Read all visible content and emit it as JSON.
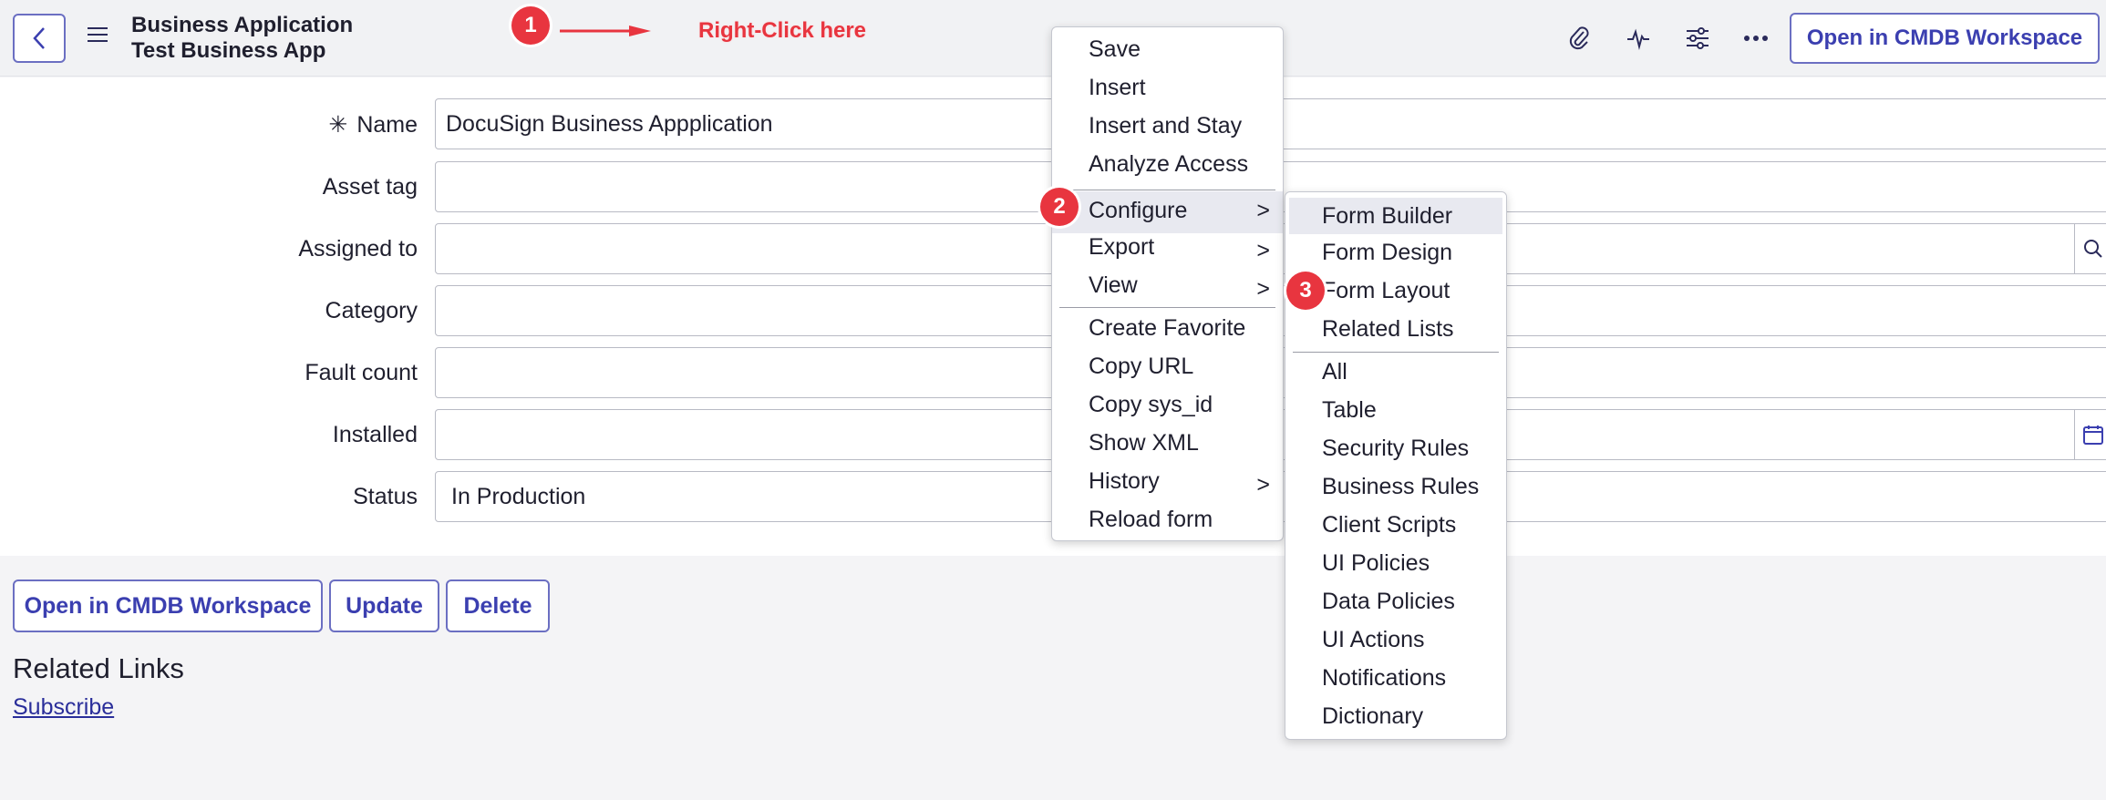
{
  "header": {
    "title_line1": "Business Application",
    "title_line2": "Test Business App",
    "open_cmdb_label": "Open in CMDB Workspace",
    "icons": [
      "back-icon",
      "hamburger-menu-icon",
      "paperclip-icon",
      "activity-icon",
      "sliders-icon",
      "more-icon"
    ]
  },
  "annotations": {
    "step1": "1",
    "step1_text": "Right-Click here",
    "step2": "2",
    "step3": "3",
    "color": "#e8353f"
  },
  "form": {
    "required_marker": "✳",
    "fields": [
      {
        "label": "Name",
        "value": "DocuSign Business Appplication"
      },
      {
        "label": "Asset tag",
        "value": ""
      },
      {
        "label": "Assigned to",
        "value": ""
      },
      {
        "label": "Category",
        "value": ""
      },
      {
        "label": "Fault count",
        "value": ""
      },
      {
        "label": "Installed",
        "value": ""
      },
      {
        "label": "Status",
        "value": "In Production"
      }
    ]
  },
  "actions": {
    "open_cmdb": "Open in CMDB Workspace",
    "update": "Update",
    "delete": "Delete"
  },
  "related": {
    "title": "Related Links",
    "subscribe": "Subscribe"
  },
  "context_menu": {
    "items": [
      "Save",
      "Insert",
      "Insert and Stay",
      "Analyze Access",
      "Configure",
      "Export",
      "View",
      "Create Favorite",
      "Copy URL",
      "Copy sys_id",
      "Show XML",
      "History",
      "Reload form"
    ],
    "chevron": ">"
  },
  "configure_submenu": {
    "items": [
      "Form Builder",
      "Form Design",
      "Form Layout",
      "Related Lists",
      "All",
      "Table",
      "Security Rules",
      "Business Rules",
      "Client Scripts",
      "UI Policies",
      "Data Policies",
      "UI Actions",
      "Notifications",
      "Dictionary"
    ]
  },
  "colors": {
    "accent": "#3b3fb0",
    "border_accent": "#6b6fc2",
    "annotation": "#e8353f"
  }
}
